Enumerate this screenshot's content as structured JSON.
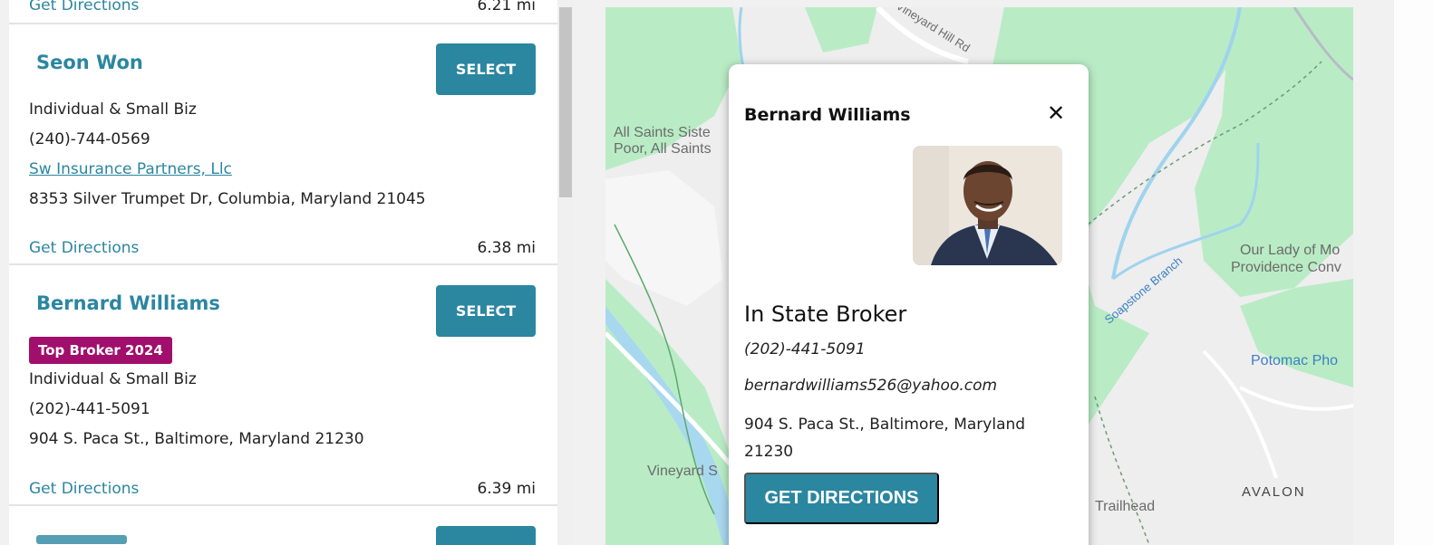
{
  "list": {
    "prev_entry": {
      "directions_label": "Get Directions",
      "distance": "6.21 mi"
    },
    "entries": [
      {
        "name": "Seon Won",
        "select_label": "SELECT",
        "lines": [
          "Individual & Small Biz",
          "(240)-744-0569"
        ],
        "company_link": "Sw Insurance Partners, Llc",
        "address": "8353 Silver Trumpet Dr, Columbia, Maryland 21045",
        "directions_label": "Get Directions",
        "distance": "6.38 mi"
      },
      {
        "name": "Bernard Williams",
        "select_label": "SELECT",
        "badge": "Top Broker 2024",
        "lines": [
          "Individual & Small Biz",
          "(202)-441-5091"
        ],
        "address": "904 S. Paca St., Baltimore, Maryland 21230",
        "directions_label": "Get Directions",
        "distance": "6.39 mi"
      }
    ]
  },
  "map": {
    "labels": {
      "vineyard_hill": "Vineyard Hill Rd",
      "all_saints_1": "All Saints Siste",
      "all_saints_2": "Poor, All Saints",
      "our_lady_1": "Our Lady of Mo",
      "our_lady_2": "Providence Conv",
      "soapstone": "Soapstone Branch",
      "potomac": "Potomac Pho",
      "vineyard_s": "Vineyard S",
      "trailhead": "Trailhead",
      "avalon": "AVALON"
    },
    "colors": {
      "park": "#b9ecc5",
      "water": "#a8d8f0",
      "land": "#eeeeee"
    }
  },
  "popup": {
    "name": "Bernard Williams",
    "close_icon": "close-icon",
    "type": "In State Broker",
    "phone": "(202)-441-5091",
    "email": "bernardwilliams526@yahoo.com",
    "address": "904 S. Paca St., Baltimore, Maryland 21230",
    "directions_label": "GET DIRECTIONS"
  },
  "colors": {
    "accent": "#2b86a0",
    "badge": "#a10e6b"
  }
}
